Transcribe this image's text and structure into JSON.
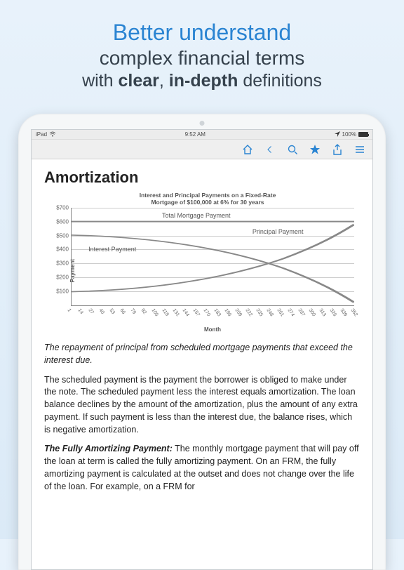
{
  "marketing": {
    "line1": "Better understand",
    "line2": "complex financial terms",
    "line3_pre": "with ",
    "line3_b1": "clear",
    "line3_mid": ", ",
    "line3_b2": "in-depth",
    "line3_suf": " definitions"
  },
  "statusbar": {
    "carrier": "iPad",
    "time": "9:52 AM",
    "battery": "100%"
  },
  "toolbar": {
    "home": "home-icon",
    "back": "back-icon",
    "search": "search-icon",
    "favorite": "star-icon",
    "share": "share-icon",
    "menu": "menu-icon"
  },
  "article": {
    "title": "Amortization",
    "lede": "The repayment of principal from scheduled mortgage payments that exceed the interest due.",
    "p1": "The scheduled payment is the payment the borrower is obliged to make under the note. The scheduled payment less the interest equals amortization. The loan balance declines by the amount of the amortization, plus the amount of any extra payment. If such payment is less than the interest due, the balance rises, which is negative amortization.",
    "p2_head": "The Fully Amortizing Payment:",
    "p2": " The monthly mortgage payment that will pay off the loan at term is called the fully amortizing payment. On an FRM, the fully amortizing payment is calculated at the outset and does not change over the life of the loan. For example, on a FRM for"
  },
  "chart_data": {
    "type": "line",
    "title_l1": "Interest and Principal Payments on a Fixed-Rate",
    "title_l2": "Mortgage of $100,000 at 6% for 30 years",
    "xlabel": "Month",
    "ylabel": "Payment",
    "yticks": [
      "$700",
      "$600",
      "$500",
      "$400",
      "$300",
      "$200",
      "$100"
    ],
    "xticks": [
      "1",
      "14",
      "27",
      "40",
      "53",
      "66",
      "79",
      "92",
      "105",
      "118",
      "131",
      "144",
      "157",
      "170",
      "183",
      "196",
      "209",
      "222",
      "235",
      "248",
      "261",
      "274",
      "287",
      "300",
      "313",
      "326",
      "339",
      "352"
    ],
    "series": [
      {
        "name": "Total Mortgage Payment",
        "values_desc": "constant ~$600"
      },
      {
        "name": "Interest Payment",
        "values_desc": "starts ~$500 declines to ~$0"
      },
      {
        "name": "Principal Payment",
        "values_desc": "starts ~$100 rises to ~$600"
      }
    ],
    "annotations": {
      "total": "Total Mortgage Payment",
      "interest": "Interest Payment",
      "principal": "Principal Payment"
    },
    "ylim": [
      0,
      700
    ]
  }
}
